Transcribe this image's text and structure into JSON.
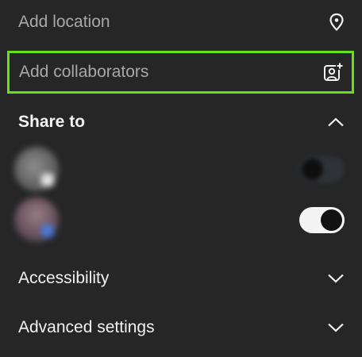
{
  "location": {
    "label": "Add location",
    "icon": "location-pin-icon"
  },
  "collaborators": {
    "label": "Add collaborators",
    "icon": "add-person-icon",
    "highlight_color": "#64e01c"
  },
  "share": {
    "title": "Share to",
    "accounts": [
      {
        "name": "",
        "subtitle": "",
        "enabled": false
      },
      {
        "name": "",
        "subtitle": "",
        "enabled": true
      }
    ]
  },
  "accessibility": {
    "label": "Accessibility"
  },
  "advanced": {
    "label": "Advanced settings"
  },
  "colors": {
    "background": "#262626",
    "text": "#f2f2f2",
    "muted": "#a8a8a8"
  }
}
